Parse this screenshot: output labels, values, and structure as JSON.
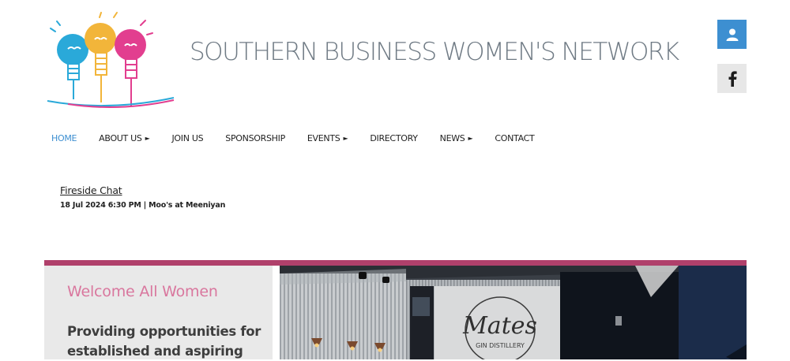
{
  "site": {
    "title": "SOUTHERN BUSINESS WOMEN'S NETWORK",
    "brand_colors": {
      "blue": "#3d8fd1",
      "pink": "#d9779e",
      "banner": "#b0406b"
    }
  },
  "side_buttons": {
    "member_icon": "user-icon",
    "facebook_icon": "facebook-icon"
  },
  "nav": {
    "items": [
      {
        "label": "HOME",
        "active": true
      },
      {
        "label": "ABOUT US",
        "submenu": true
      },
      {
        "label": "JOIN US"
      },
      {
        "label": "SPONSORSHIP"
      },
      {
        "label": "EVENTS",
        "submenu": true
      },
      {
        "label": "DIRECTORY"
      },
      {
        "label": "NEWS",
        "submenu": true
      },
      {
        "label": "CONTACT"
      }
    ],
    "submenu_marker": "►"
  },
  "event": {
    "title": "Fireside Chat",
    "meta": "18 Jul 2024 6:30 PM | Moo's at Meeniyan"
  },
  "banner": {
    "welcome_title": "Welcome All Women",
    "welcome_body": "Providing opportunities for established and aspiring",
    "photo_sign": "Mates",
    "photo_sign_sub": "GIN DISTILLERY"
  }
}
